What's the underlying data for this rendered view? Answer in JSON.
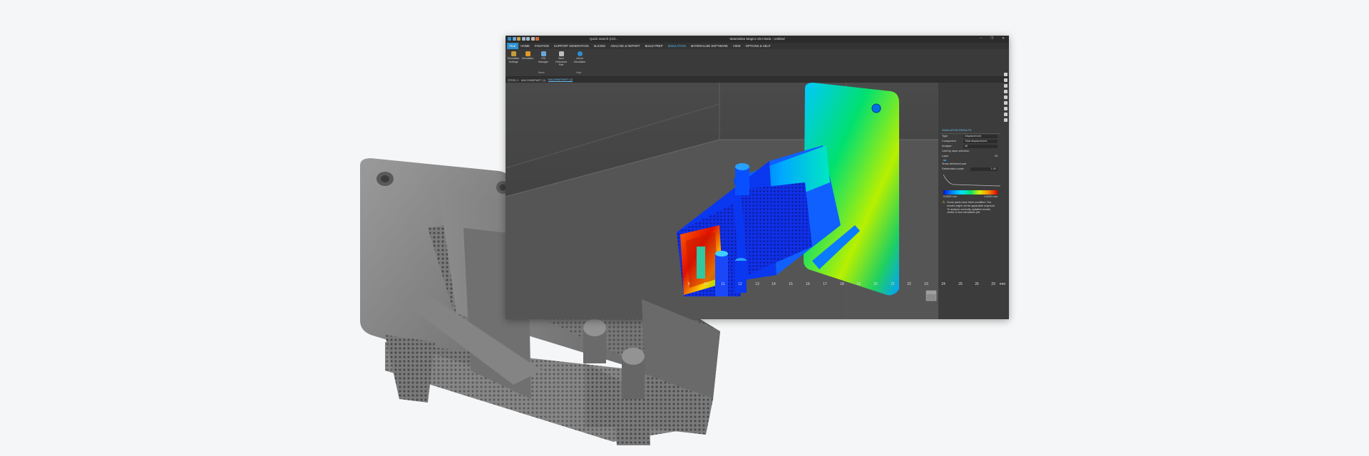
{
  "window": {
    "title": "Materialise Magics 28.0 Beta - Untitled",
    "quick_search": "Quick search (Ctrl...",
    "controls": [
      "–",
      "❐",
      "✕"
    ]
  },
  "menu": {
    "items": [
      "FILE",
      "HOME",
      "POSITION",
      "SUPPORT GENERATION",
      "SLICING",
      "ANALYZE & REPORT",
      "BUILD PREP",
      "SIMULATION",
      "MATERIALISE SOFTWARE",
      "VIEW",
      "OPTIONS & HELP"
    ],
    "selected_index": 0,
    "active_index": 7
  },
  "ribbon": {
    "buttons": [
      {
        "label": "Simulation Settings",
        "color": "#c89a3a"
      },
      {
        "label": "Simulation",
        "color": "#e09a2a"
      },
      {
        "label": "VSI Manager",
        "color": "#6aa6d6"
      },
      {
        "label": "Save Deformed Part",
        "color": "#bdbdbd"
      },
      {
        "label": "About Simulation",
        "color": "#2e8fcf"
      }
    ],
    "group_labels": [
      "Basic",
      "Help"
    ]
  },
  "scene_tabs": [
    "STEEL 1",
    "MACHINEPART (1)",
    "MACHINEPART (2)"
  ],
  "sim_panel": {
    "header": "SIMULATION RESULTS",
    "rows": [
      {
        "key": "Type",
        "value": "Displacement"
      },
      {
        "key": "Component",
        "value": "Total displacement"
      },
      {
        "key": "Analyse",
        "value": "All"
      }
    ],
    "limit_label": "Limit by layer selection",
    "layer_label": "Layer",
    "layer_value": "43",
    "show_deformed": "Show deformed part",
    "deformation_scale": "Deformation scale",
    "scale_value": "1.00",
    "legend_min": "0.0000 mm",
    "legend_max": "1.0000 mm",
    "note": "Some parts have been modified. The results might not be applicable anymore. To analyze correctly updated results, create a new simulation job."
  },
  "ruler": {
    "ticks": [
      "9",
      "10",
      "11",
      "12",
      "13",
      "14",
      "15",
      "16",
      "17",
      "18",
      "19",
      "20",
      "21",
      "22",
      "23",
      "24",
      "25",
      "26",
      "29"
    ],
    "unit": "mm"
  },
  "colors": {
    "accent": "#2e8fcf",
    "active_text": "#4fb0ea",
    "app_bg": "#3c3c3c",
    "page_bg": "#f5f6f7"
  },
  "icons": [
    "app-logo-icon",
    "save-icon",
    "undo-icon",
    "redo-icon",
    "search-icon",
    "minimize-icon",
    "maximize-icon",
    "close-icon",
    "warning-icon",
    "view-cube-icon"
  ]
}
